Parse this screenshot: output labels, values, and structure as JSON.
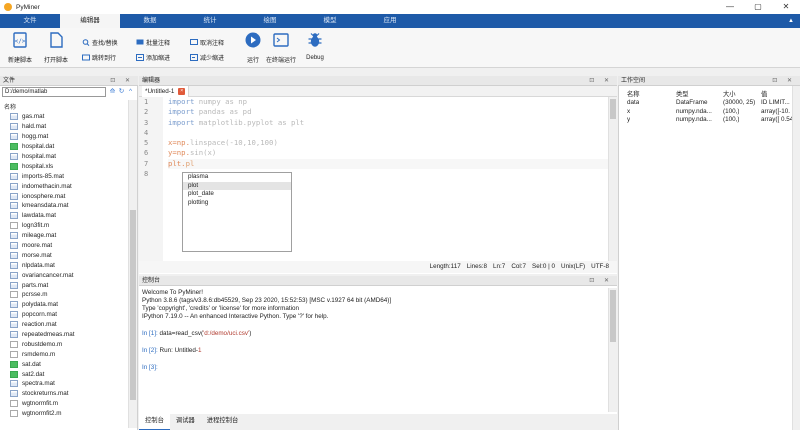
{
  "window": {
    "title": "PyMiner",
    "controls": [
      "—",
      "▢",
      "✕"
    ]
  },
  "menu": {
    "tabs": [
      "文件",
      "编辑器",
      "数据",
      "统计",
      "绘图",
      "模型",
      "应用"
    ],
    "active_index": 1,
    "collapse": "▲"
  },
  "ribbon": {
    "new_script": "新建脚本",
    "open_script": "打开脚本",
    "find_replace": "查找/替换",
    "goto_line": "跳转到行",
    "batch_comment": "批量注释",
    "add_indent": "添加缩进",
    "uncomment": "取消注释",
    "reduce_indent": "减少缩进",
    "run": "运行",
    "run_terminal": "在终端运行",
    "debug": "Debug"
  },
  "file_panel": {
    "title": "文件",
    "controls": "⊡ ✕",
    "path": "D:/demo/matlab",
    "path_buttons": [
      "⟰",
      "↻",
      "^"
    ],
    "column_header": "名称",
    "files": [
      {
        "name": "gas.mat",
        "type": "mat"
      },
      {
        "name": "hald.mat",
        "type": "mat"
      },
      {
        "name": "hogg.mat",
        "type": "mat"
      },
      {
        "name": "hospital.dat",
        "type": "dat"
      },
      {
        "name": "hospital.mat",
        "type": "mat"
      },
      {
        "name": "hospital.xls",
        "type": "xls"
      },
      {
        "name": "imports-85.mat",
        "type": "mat"
      },
      {
        "name": "indomethacin.mat",
        "type": "mat"
      },
      {
        "name": "ionosphere.mat",
        "type": "mat"
      },
      {
        "name": "kmeansdata.mat",
        "type": "mat"
      },
      {
        "name": "lawdata.mat",
        "type": "mat"
      },
      {
        "name": "logn3fit.m",
        "type": "m"
      },
      {
        "name": "mileage.mat",
        "type": "mat"
      },
      {
        "name": "moore.mat",
        "type": "mat"
      },
      {
        "name": "morse.mat",
        "type": "mat"
      },
      {
        "name": "nlpdata.mat",
        "type": "mat"
      },
      {
        "name": "ovariancancer.mat",
        "type": "mat"
      },
      {
        "name": "parts.mat",
        "type": "mat"
      },
      {
        "name": "pcrsse.m",
        "type": "m"
      },
      {
        "name": "polydata.mat",
        "type": "mat"
      },
      {
        "name": "popcorn.mat",
        "type": "mat"
      },
      {
        "name": "reaction.mat",
        "type": "mat"
      },
      {
        "name": "repeatedmeas.mat",
        "type": "mat"
      },
      {
        "name": "robustdemo.m",
        "type": "m"
      },
      {
        "name": "rsmdemo.m",
        "type": "m"
      },
      {
        "name": "sat.dat",
        "type": "dat"
      },
      {
        "name": "sat2.dat",
        "type": "dat"
      },
      {
        "name": "spectra.mat",
        "type": "mat"
      },
      {
        "name": "stockreturns.mat",
        "type": "mat"
      },
      {
        "name": "wgtnormfit.m",
        "type": "m"
      },
      {
        "name": "wgtnormfit2.m",
        "type": "m"
      }
    ]
  },
  "editor": {
    "title": "编辑器",
    "controls": "⊡ ✕",
    "tab_label": "*Untitled-1",
    "tab_close": "×",
    "line_numbers": [
      "1",
      "2",
      "3",
      "4",
      "5",
      "6",
      "7",
      "8"
    ],
    "lines": [
      {
        "kw": "import",
        "rest": " numpy as np"
      },
      {
        "kw": "import",
        "rest": " pandas as pd"
      },
      {
        "kw": "import",
        "rest": " matplotlib.pyplot as plt"
      },
      {
        "kw": "",
        "rest": ""
      },
      {
        "kw": "x=np.",
        "rest": "linspace(-10,10,100)"
      },
      {
        "kw": "y=np.",
        "rest": "sin(x)"
      },
      {
        "kw": "plt.",
        "rest": "pl"
      },
      {
        "kw": "",
        "rest": ""
      }
    ],
    "completions": [
      "plasma",
      "plot",
      "plot_date",
      "plotting"
    ],
    "selected_completion": 1,
    "status": [
      "Length:117",
      "Lines:8",
      "Ln:7",
      "Col:7",
      "Sel:0 | 0",
      "Unix(LF)",
      "UTF-8"
    ]
  },
  "console": {
    "title": "控制台",
    "controls": "⊡ ✕",
    "welcome": "Welcome To PyMiner!",
    "python_version": "Python 3.8.6 (tags/v3.8.6:db45529, Sep 23 2020, 15:52:53) [MSC v.1927 64 bit (AMD64)]",
    "type_help": "Type 'copyright', 'credits' or 'license' for more information",
    "ipython": "IPython 7.19.0 -- An enhanced Interactive Python. Type '?' for help.",
    "in1_prompt": "In [1]:",
    "in1_code_a": " data=read_csv(",
    "in1_code_path": "'d:/demo/uci.csv'",
    "in1_code_b": ")",
    "in2_prompt": "In [2]:",
    "in2_code": " Run: Untitled-",
    "in2_num": "1",
    "in3_prompt": "In [3]:",
    "tabs": [
      "控制台",
      "调试器",
      "进程控制台"
    ]
  },
  "workspace": {
    "title": "工作空间",
    "controls": "⊡ ✕",
    "headers": [
      "名称",
      "类型",
      "大小",
      "值"
    ],
    "rows": [
      [
        "data",
        "DataFrame",
        "(30000, 25)",
        "ID LIMIT..."
      ],
      [
        "x",
        "numpy.nda...",
        "(100,)",
        "array([-10. ..."
      ],
      [
        "y",
        "numpy.nda...",
        "(100,)",
        "array([ 0.54402..."
      ]
    ]
  },
  "colors": {
    "menubar": "#1e5aa8",
    "accent": "#2d6cc0"
  }
}
